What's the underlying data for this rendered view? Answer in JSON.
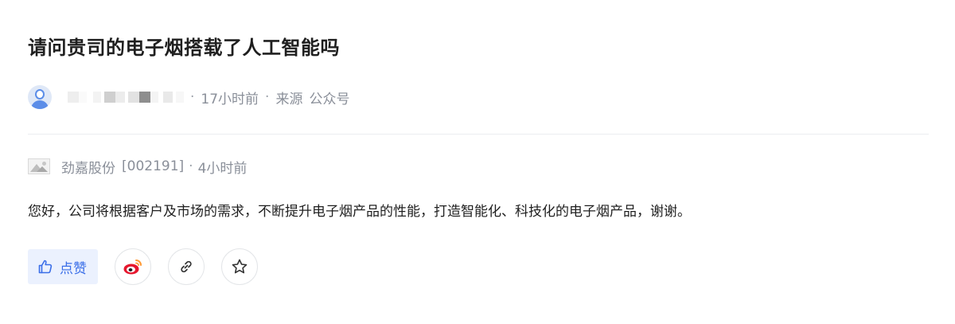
{
  "question": {
    "title": "请问贵司的电子烟搭载了人工智能吗",
    "time": "17小时前",
    "separator": "·",
    "source_label": "来源",
    "source_value": "公众号"
  },
  "answer": {
    "company": "劲嘉股份",
    "stock_code": "[002191]",
    "separator": "·",
    "time": "4小时前",
    "body": "您好，公司将根据客户及市场的需求，不断提升电子烟产品的性能，打造智能化、科技化的电子烟产品，谢谢。"
  },
  "actions": {
    "like_label": "点赞"
  },
  "icons": {
    "avatar": "user-avatar-icon",
    "company_logo": "company-logo-placeholder",
    "like": "thumbs-up-icon",
    "weibo": "weibo-icon",
    "link": "link-icon",
    "star": "star-icon"
  },
  "colors": {
    "accent": "#3a6ee8",
    "like_bg": "#ebf1fe",
    "weibo_red": "#e6162d",
    "weibo_orange": "#ff9933",
    "meta_text": "#8a8f99"
  }
}
